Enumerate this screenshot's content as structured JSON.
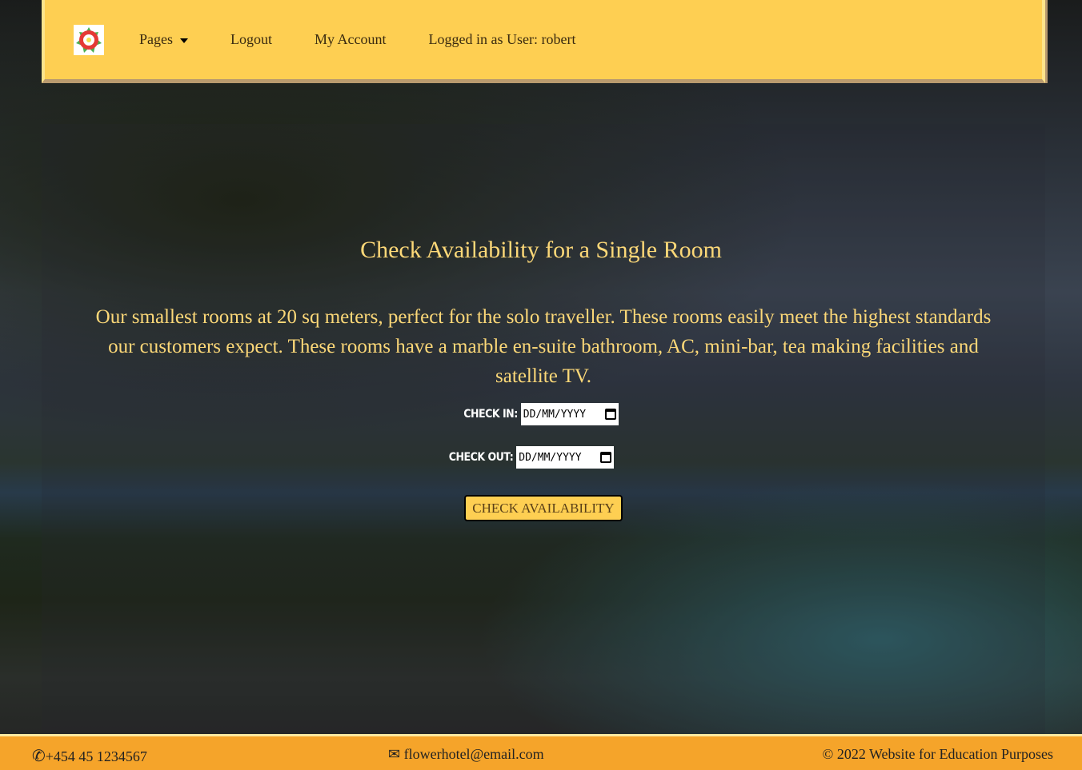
{
  "nav": {
    "pages": "Pages",
    "logout": "Logout",
    "account": "My Account",
    "user": "Logged in as User: robert"
  },
  "main": {
    "title": "Check Availability for a Single Room",
    "description": "Our smallest rooms at 20 sq meters, perfect for the solo traveller. These rooms easily meet the highest standards our customers expect. These rooms have a marble en-suite bathroom, AC, mini-bar, tea making facilities and satellite TV.",
    "check_in_label": "CHECK IN:",
    "check_out_label": "CHECK OUT:",
    "date_placeholder": "DD/MM/YYYY",
    "button": "CHECK AVAILABILITY"
  },
  "footer": {
    "phone": "+454 45 1234567",
    "email": "flowerhotel@email.com",
    "copyright": "© 2022 Website for Education Purposes"
  }
}
